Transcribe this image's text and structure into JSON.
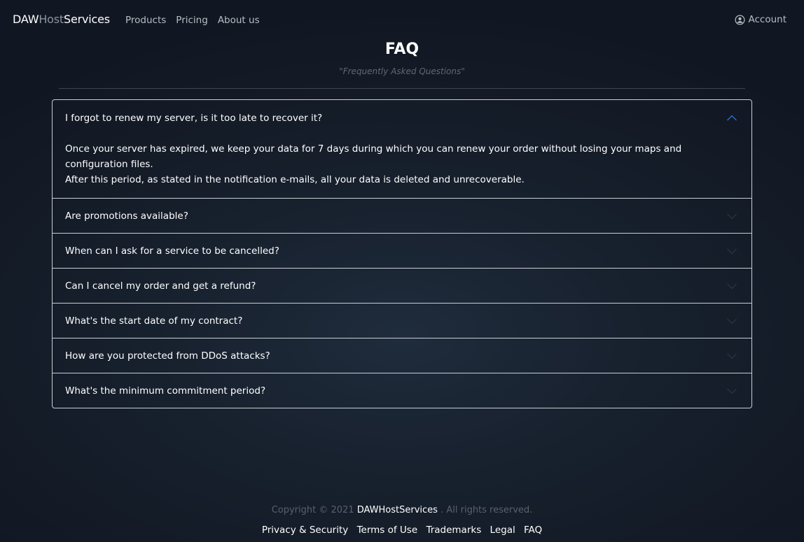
{
  "navbar": {
    "brand": {
      "part1": "DAW",
      "part2": "Host",
      "part3": "Services"
    },
    "links": [
      "Products",
      "Pricing",
      "About us"
    ],
    "account_label": "Account",
    "account_icon": "user-circle-icon"
  },
  "header": {
    "title": "FAQ",
    "subtitle": "\"Frequently Asked Questions\""
  },
  "faq": {
    "items": [
      {
        "question": "I forgot to renew my server, is it too late to recover it?",
        "answer_line1": "Once your server has expired, we keep your data for 7 days during which you can renew your order without losing your maps and configuration files.",
        "answer_line2": "After this period, as stated in the notification e-mails, all your data is deleted and unrecoverable.",
        "expanded": true
      },
      {
        "question": "Are promotions available?",
        "expanded": false
      },
      {
        "question": "When can I ask for a service to be cancelled?",
        "expanded": false
      },
      {
        "question": "Can I cancel my order and get a refund?",
        "expanded": false
      },
      {
        "question": "What's the start date of my contract?",
        "expanded": false
      },
      {
        "question": "How are you protected from DDoS attacks?",
        "expanded": false
      },
      {
        "question": "What's the minimum commitment period?",
        "expanded": false
      }
    ],
    "chevron_up_icon": "chevron-up-icon",
    "chevron_down_icon": "chevron-down-icon",
    "accent_color": "#2f6fd6"
  },
  "footer": {
    "copyright_prefix": "Copyright © 2021",
    "copyright_brand": "DAWHostServices",
    "copyright_suffix": ". All rights reserved.",
    "links": [
      "Privacy & Security",
      "Terms of Use",
      "Trademarks",
      "Legal",
      "FAQ"
    ]
  },
  "colors": {
    "background": "#161e2a",
    "muted_text": "#59616b",
    "border": "#c9ced4"
  }
}
